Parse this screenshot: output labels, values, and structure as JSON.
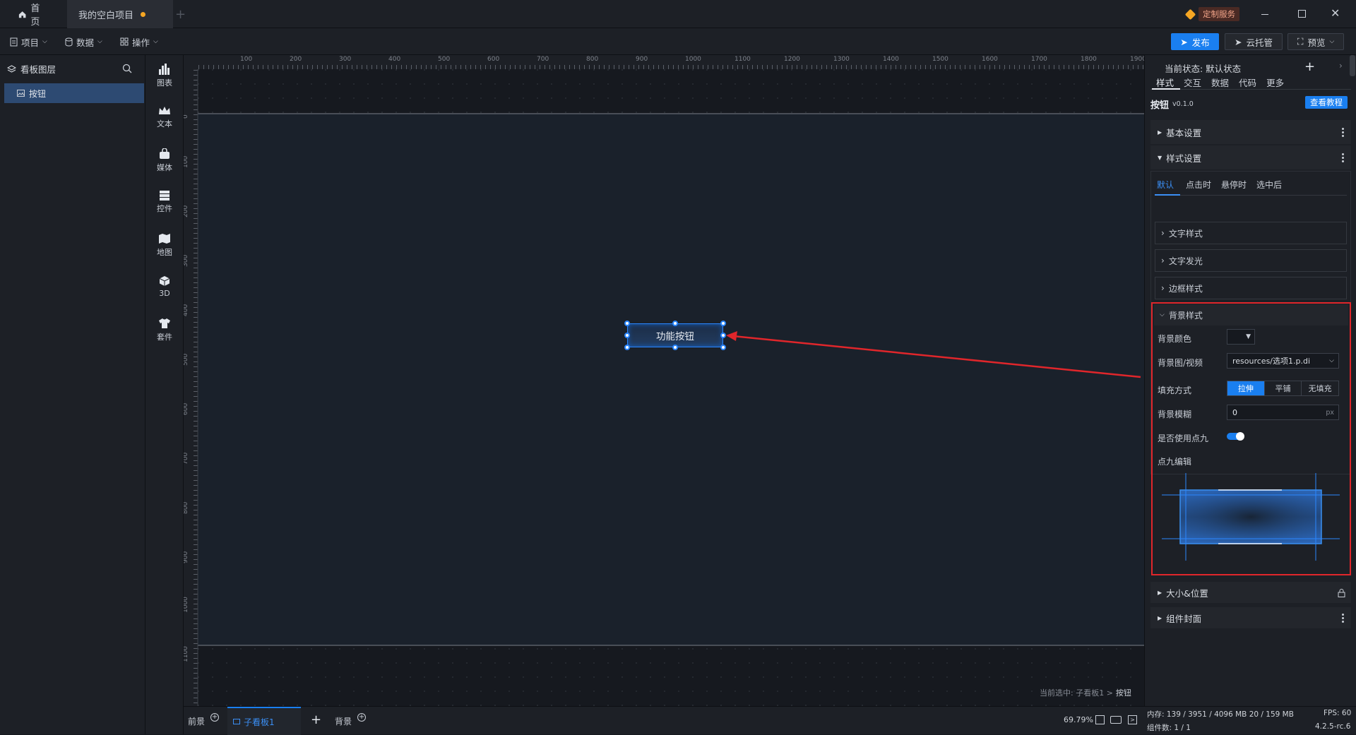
{
  "titlebar": {
    "home_tab": "首页",
    "project_tab": "我的空白项目",
    "custom_service": "定制服务"
  },
  "toolbar": {
    "menu_project": "项目",
    "menu_data": "数据",
    "menu_ops": "操作",
    "publish": "发布",
    "cloud_host": "云托管",
    "preview": "预览"
  },
  "layers": {
    "title": "看板图层",
    "items": [
      {
        "label": "按钮"
      }
    ]
  },
  "tools": [
    {
      "label": "图表",
      "icon": "bar-chart-icon"
    },
    {
      "label": "文本",
      "icon": "crown-text-icon"
    },
    {
      "label": "媒体",
      "icon": "media-bag-icon"
    },
    {
      "label": "控件",
      "icon": "widget-list-icon"
    },
    {
      "label": "地图",
      "icon": "map-icon"
    },
    {
      "label": "3D",
      "icon": "cube-icon"
    },
    {
      "label": "套件",
      "icon": "shirt-icon"
    }
  ],
  "ruler": {
    "h_ticks": [
      "100",
      "200",
      "300",
      "400",
      "500",
      "600",
      "700",
      "800",
      "900",
      "1000",
      "1100",
      "1200",
      "1300",
      "1400",
      "1500",
      "1600",
      "1700",
      "1800",
      "1900"
    ],
    "v_ticks": [
      "0",
      "100",
      "200",
      "300",
      "400",
      "500",
      "600",
      "700",
      "800",
      "900",
      "1000",
      "1100"
    ]
  },
  "canvas": {
    "button_label": "功能按钮",
    "selection_prefix": "当前选中: 子看板1 >",
    "selection_target": "按钮"
  },
  "bottombar": {
    "foreground": "前景",
    "sub_board": "子看板1",
    "background": "背景",
    "zoom": "69.79%"
  },
  "rpanel": {
    "state_label": "当前状态: 默认状态",
    "tabs": [
      "样式",
      "交互",
      "数据",
      "代码",
      "更多"
    ],
    "component_name": "按钮",
    "component_version": "v0.1.0",
    "tutorial": "查看教程",
    "basic_settings": "基本设置",
    "style_settings": "样式设置",
    "state_tabs": [
      "默认",
      "点击时",
      "悬停时",
      "选中后"
    ],
    "text_style": "文字样式",
    "text_glow": "文字发光",
    "border_style": "边框样式",
    "bg_style": "背景样式",
    "bg_color_label": "背景颜色",
    "bg_image_label": "背景图/视频",
    "bg_image_value": "resources/选项1.p.di",
    "fill_mode_label": "填充方式",
    "fill_modes": [
      "拉伸",
      "平铺",
      "无填充"
    ],
    "blur_label": "背景模糊",
    "blur_value": "0",
    "blur_unit": "px",
    "nine_patch_label": "是否使用点九",
    "nine_patch_on": true,
    "nine_patch_edit": "点九编辑",
    "size_position": "大小&位置",
    "cover": "组件封面"
  },
  "status": {
    "memory": "内存: 139 / 3951 / 4096 MB 20 / 159 MB",
    "fps": "FPS: 60",
    "count": "组件数: 1 / 1",
    "version": "4.2.5-rc.6"
  },
  "colors": {
    "accent": "#1a7ff0",
    "highlight_red": "#e0262b",
    "bg": "#16191f",
    "panel": "#1d2026"
  }
}
